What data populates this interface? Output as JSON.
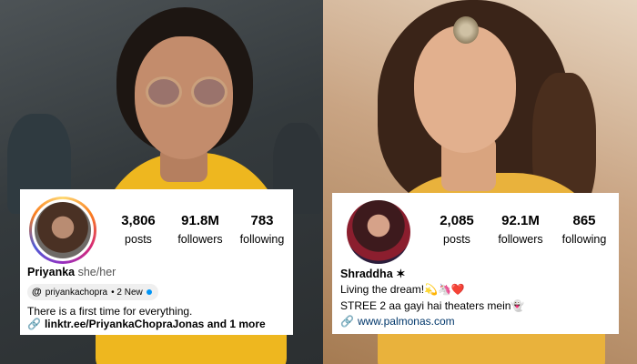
{
  "profiles": [
    {
      "stats": [
        {
          "value": "3,806",
          "label": "posts"
        },
        {
          "value": "91.8M",
          "label": "followers"
        },
        {
          "value": "783",
          "label": "following"
        }
      ],
      "name": "Priyanka",
      "pronouns": "she/her",
      "threads_handle": "priyankachopra",
      "threads_badge": "• 2 New",
      "bio": "There is a first time for everything.",
      "link": "linktr.ee/PriyankaChopraJonas and 1 more"
    },
    {
      "stats": [
        {
          "value": "2,085",
          "label": "posts"
        },
        {
          "value": "92.1M",
          "label": "followers"
        },
        {
          "value": "865",
          "label": "following"
        }
      ],
      "name": "Shraddha ✶",
      "bio_line_1": "Living the dream!💫🦄❤️",
      "bio_line_2": "STREE 2 aa gayi hai theaters mein👻",
      "link": "www.palmonas.com"
    }
  ],
  "icons": {
    "threads": "threads-icon",
    "link": "link-icon"
  },
  "colors": {
    "threads_dot": "#0095f6",
    "link_blue": "#00376b"
  }
}
